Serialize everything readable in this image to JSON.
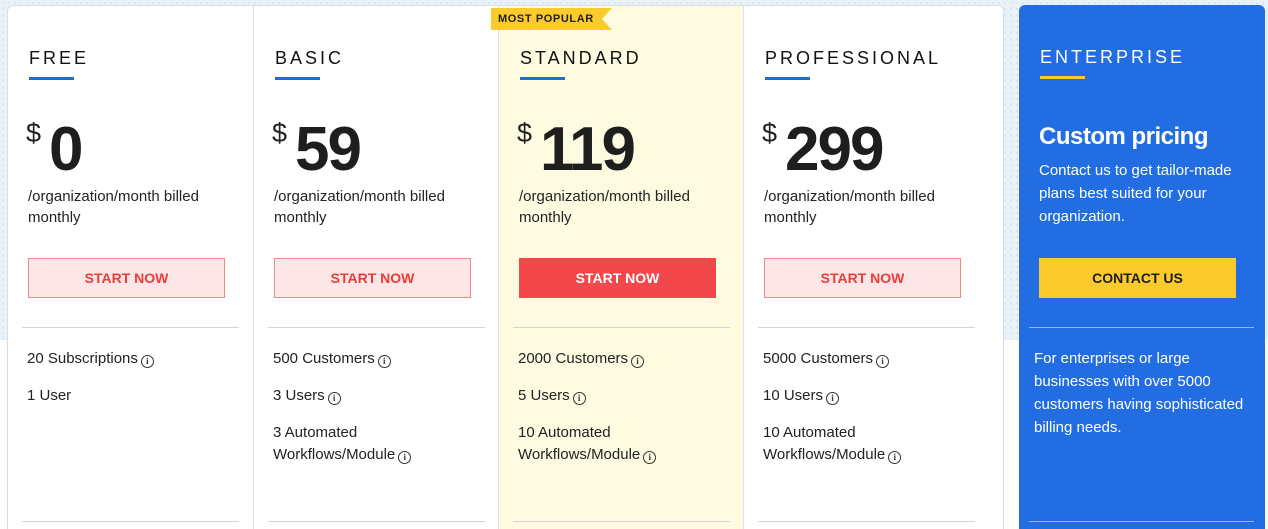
{
  "badge": "MOST POPULAR",
  "plans": [
    {
      "name": "FREE",
      "currency": "$",
      "price": "0",
      "billing": "/organization/month billed monthly",
      "cta": "START NOW",
      "features": [
        {
          "text": "20 Subscriptions",
          "info": true
        },
        {
          "text": "1 User",
          "info": false
        }
      ]
    },
    {
      "name": "BASIC",
      "currency": "$",
      "price": "59",
      "billing": "/organization/month billed monthly",
      "cta": "START NOW",
      "features": [
        {
          "text": "500 Customers",
          "info": true
        },
        {
          "text": "3 Users",
          "info": true
        },
        {
          "text": "3 Automated Workflows/Module",
          "info": true
        }
      ]
    },
    {
      "name": "STANDARD",
      "currency": "$",
      "price": "119",
      "billing": "/organization/month billed monthly",
      "cta": "START NOW",
      "features": [
        {
          "text": "2000 Customers",
          "info": true
        },
        {
          "text": "5 Users",
          "info": true
        },
        {
          "text": "10 Automated Workflows/Module",
          "info": true
        }
      ]
    },
    {
      "name": "PROFESSIONAL",
      "currency": "$",
      "price": "299",
      "billing": "/organization/month billed monthly",
      "cta": "START NOW",
      "features": [
        {
          "text": "5000 Customers",
          "info": true
        },
        {
          "text": "10 Users",
          "info": true
        },
        {
          "text": "10 Automated Workflows/Module",
          "info": true
        }
      ]
    }
  ],
  "enterprise": {
    "name": "ENTERPRISE",
    "heading": "Custom pricing",
    "description": "Contact us to get tailor-made plans best suited for your organization.",
    "cta": "CONTACT US",
    "note": "For enterprises or large businesses with over 5000 customers having sophisticated billing needs."
  },
  "icons": {
    "info": "info-icon"
  },
  "colors": {
    "accent_blue": "#226de1",
    "accent_yellow": "#fbcb2d",
    "cta_red": "#f2474b",
    "popular_bg": "#fffbe0"
  }
}
